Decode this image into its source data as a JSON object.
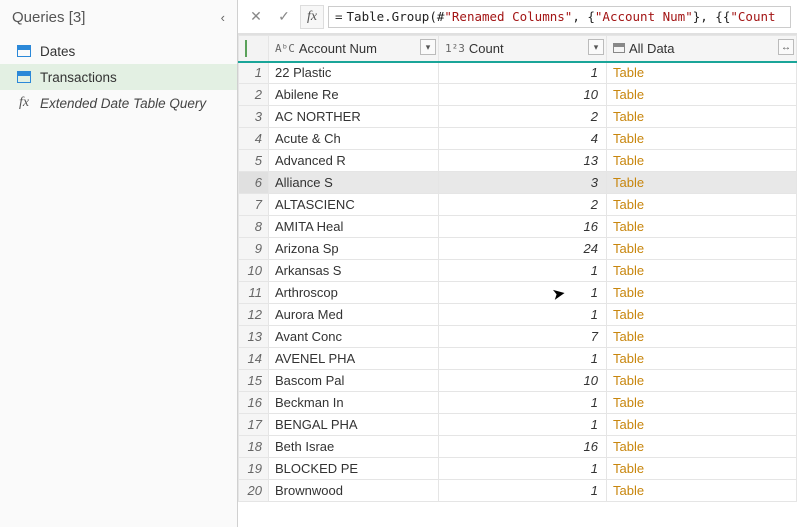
{
  "queries": {
    "title": "Queries [3]",
    "items": [
      {
        "label": "Dates",
        "type": "table",
        "selected": false
      },
      {
        "label": "Transactions",
        "type": "table",
        "selected": true
      },
      {
        "label": "Extended Date Table Query",
        "type": "fx",
        "selected": false
      }
    ]
  },
  "formula": {
    "parts": [
      {
        "t": "plain",
        "v": "Table.Group(#"
      },
      {
        "t": "str",
        "v": "\"Renamed Columns\""
      },
      {
        "t": "plain",
        "v": ", {"
      },
      {
        "t": "str",
        "v": "\"Account Num\""
      },
      {
        "t": "plain",
        "v": "}, {{"
      },
      {
        "t": "str",
        "v": "\"Count"
      }
    ]
  },
  "columns": {
    "acct": "Account Num",
    "count": "Count",
    "alldata": "All Data",
    "acct_type": "AᵇC",
    "count_type": "1²3"
  },
  "rows": [
    {
      "n": 1,
      "acct": "22 Plastic",
      "count": 1,
      "all": "Table"
    },
    {
      "n": 2,
      "acct": "Abilene Re",
      "count": 10,
      "all": "Table"
    },
    {
      "n": 3,
      "acct": "AC NORTHER",
      "count": 2,
      "all": "Table"
    },
    {
      "n": 4,
      "acct": "Acute & Ch",
      "count": 4,
      "all": "Table"
    },
    {
      "n": 5,
      "acct": "Advanced R",
      "count": 13,
      "all": "Table"
    },
    {
      "n": 6,
      "acct": "Alliance S",
      "count": 3,
      "all": "Table",
      "selected": true
    },
    {
      "n": 7,
      "acct": "ALTASCIENC",
      "count": 2,
      "all": "Table"
    },
    {
      "n": 8,
      "acct": "AMITA Heal",
      "count": 16,
      "all": "Table"
    },
    {
      "n": 9,
      "acct": "Arizona Sp",
      "count": 24,
      "all": "Table"
    },
    {
      "n": 10,
      "acct": "Arkansas S",
      "count": 1,
      "all": "Table"
    },
    {
      "n": 11,
      "acct": "Arthroscop",
      "count": 1,
      "all": "Table"
    },
    {
      "n": 12,
      "acct": "Aurora Med",
      "count": 1,
      "all": "Table"
    },
    {
      "n": 13,
      "acct": "Avant Conc",
      "count": 7,
      "all": "Table"
    },
    {
      "n": 14,
      "acct": "AVENEL PHA",
      "count": 1,
      "all": "Table"
    },
    {
      "n": 15,
      "acct": "Bascom Pal",
      "count": 10,
      "all": "Table"
    },
    {
      "n": 16,
      "acct": "Beckman In",
      "count": 1,
      "all": "Table"
    },
    {
      "n": 17,
      "acct": "BENGAL PHA",
      "count": 1,
      "all": "Table"
    },
    {
      "n": 18,
      "acct": "Beth Israe",
      "count": 16,
      "all": "Table"
    },
    {
      "n": 19,
      "acct": "BLOCKED PE",
      "count": 1,
      "all": "Table"
    },
    {
      "n": 20,
      "acct": "Brownwood",
      "count": 1,
      "all": "Table"
    }
  ]
}
